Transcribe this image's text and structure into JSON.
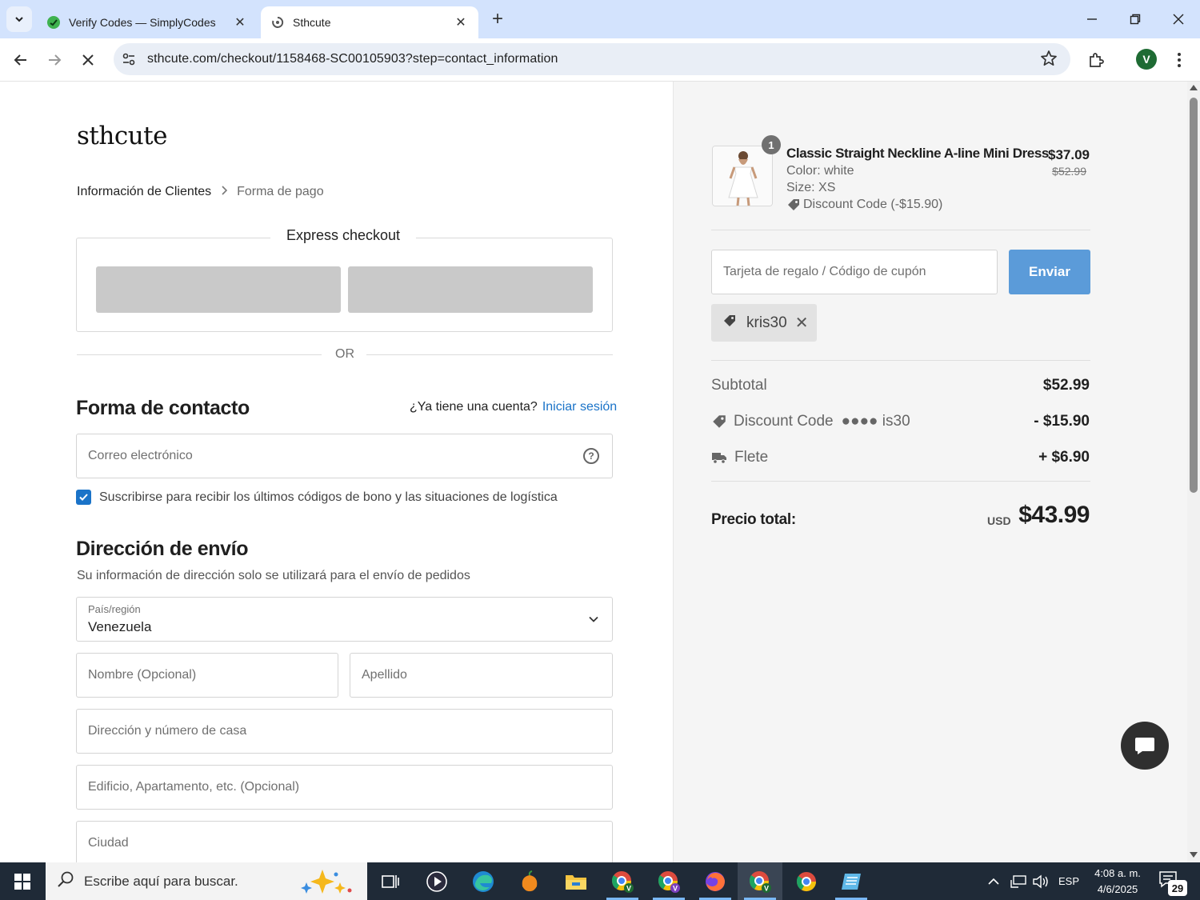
{
  "browser": {
    "tabs": [
      {
        "title": "Verify Codes — SimplyCodes",
        "active": false
      },
      {
        "title": "Sthcute",
        "active": true
      }
    ],
    "url": "sthcute.com/checkout/1158468-SC00105903?step=contact_information",
    "profile_initial": "V"
  },
  "store": {
    "logo": "sthcute"
  },
  "breadcrumb": {
    "step1": "Información de Clientes",
    "step2": "Forma de pago"
  },
  "express": {
    "title": "Express checkout",
    "or": "OR"
  },
  "contact": {
    "heading": "Forma de contacto",
    "account_prompt": "¿Ya tiene una cuenta?",
    "login_link": "Iniciar sesión",
    "email_placeholder": "Correo electrónico",
    "subscribe_label": "Suscribirse para recibir los últimos códigos de bono y las situaciones de logística",
    "subscribe_checked": true
  },
  "shipping": {
    "heading": "Dirección de envío",
    "subtitle": "Su información de dirección solo se utilizará para el envío de pedidos",
    "country_label": "País/región",
    "country_value": "Venezuela",
    "first_name_placeholder": "Nombre (Opcional)",
    "last_name_placeholder": "Apellido",
    "address_placeholder": "Dirección y número de casa",
    "address2_placeholder": "Edificio, Apartamento, etc. (Opcional)",
    "city_placeholder": "Ciudad"
  },
  "order": {
    "item": {
      "qty": "1",
      "name": "Classic Straight Neckline A-line Mini Dress",
      "color": "Color: white",
      "size": "Size: XS",
      "discount": "Discount Code (-$15.90)",
      "price": "$37.09",
      "original_price": "$52.99"
    },
    "coupon_placeholder": "Tarjeta de regalo / Código de cupón",
    "send_label": "Enviar",
    "applied_code": "kris30",
    "subtotal_label": "Subtotal",
    "subtotal_value": "$52.99",
    "discount_label": "Discount Code",
    "discount_code_masked": "●●●● is30",
    "discount_value": "- $15.90",
    "shipping_label": "Flete",
    "shipping_value": "+ $6.90",
    "total_label": "Precio total:",
    "total_currency": "USD",
    "total_value": "$43.99"
  },
  "taskbar": {
    "search_placeholder": "Escribe aquí para buscar.",
    "language": "ESP",
    "time": "4:08 a. m.",
    "date": "4/6/2025",
    "notification_count": "29"
  },
  "colors": {
    "accent": "#1a73c8",
    "button": "#5b9bd9",
    "tabbar": "#d3e3fd",
    "taskbar": "#1f2a37"
  }
}
